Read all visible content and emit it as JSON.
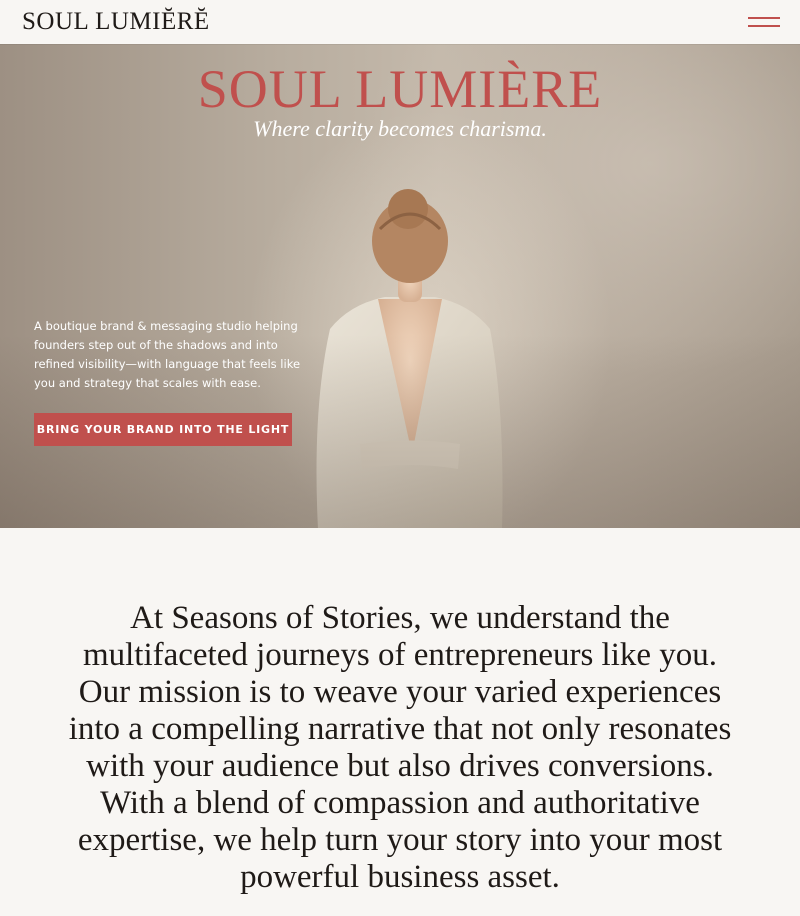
{
  "header": {
    "logo": "SOUL LUMIĔRĔ",
    "menu_icon": "hamburger-menu-icon"
  },
  "hero": {
    "title": "SOUL LUMIÈRE",
    "tagline": "Where clarity becomes charisma.",
    "description": "A boutique brand & messaging studio helping founders step out of the shadows and into refined visibility—with language that feels like you and strategy that scales with ease.",
    "cta_label": "BRING YOUR BRAND INTO THE LIGHT"
  },
  "mission": {
    "text": "At Seasons of Stories, we understand the multifaceted journeys of entrepreneurs like you. Our mission is to weave your varied experiences into a compelling narrative that not only resonates with your audience but also drives conversions. With a blend of compassion and authoritative expertise, we help turn your story into your most powerful business asset."
  },
  "colors": {
    "accent": "#c0504d",
    "background": "#f8f6f3",
    "text": "#1f1a17"
  }
}
